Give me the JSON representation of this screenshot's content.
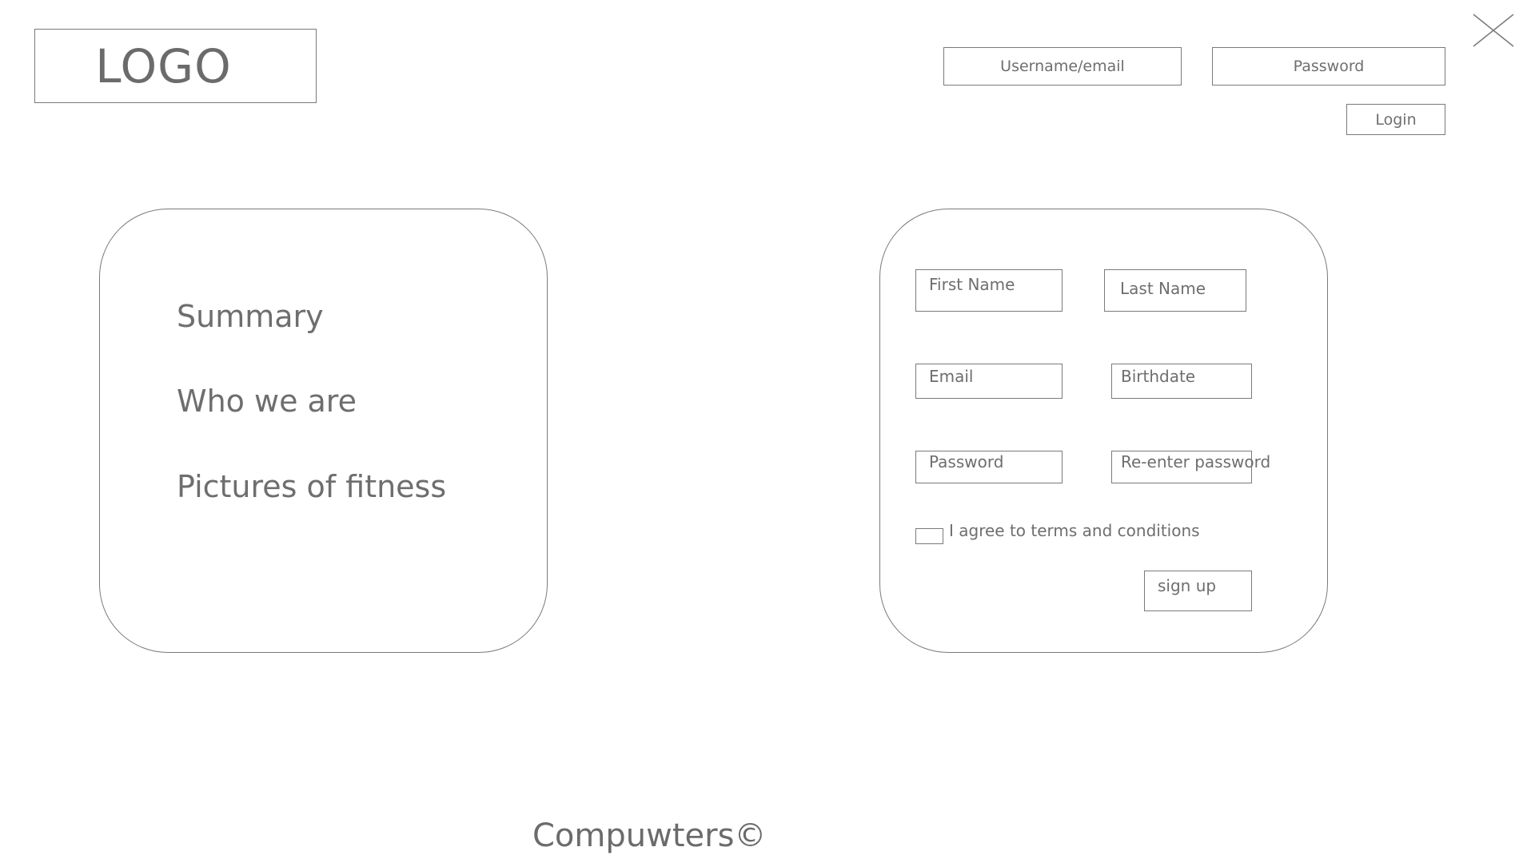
{
  "header": {
    "logo_text": "LOGO",
    "username_placeholder": "Username/email",
    "password_placeholder": "Password",
    "login_label": "Login"
  },
  "info": {
    "items": [
      "Summary",
      "Who we are",
      "Pictures of fitness"
    ]
  },
  "signup": {
    "first_name": "First Name",
    "last_name": "Last Name",
    "email": "Email",
    "birthdate": "Birthdate",
    "password": "Password",
    "reenter_password": "Re-enter password",
    "terms_label": "I agree to terms and conditions",
    "submit_label": "sign up"
  },
  "footer": {
    "text": "Compuwters©"
  },
  "icons": {
    "close": "close-icon"
  },
  "colors": {
    "line": "#7a7a7a",
    "text": "#6e6e6e",
    "background": "#ffffff"
  }
}
